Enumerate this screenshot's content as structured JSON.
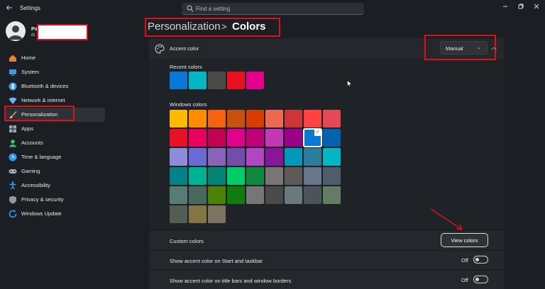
{
  "window": {
    "title": "Settings",
    "controls": [
      "minimize",
      "maximize",
      "close"
    ]
  },
  "search": {
    "placeholder": "Find a setting"
  },
  "profile": {
    "name": "Pa",
    "sub": "di"
  },
  "sidebar": {
    "items": [
      {
        "label": "Home",
        "icon": "home-icon",
        "color": "#e0863a"
      },
      {
        "label": "System",
        "icon": "monitor-icon",
        "color": "#3b9be8"
      },
      {
        "label": "Bluetooth & devices",
        "icon": "bluetooth-icon",
        "color": "#3b9be8"
      },
      {
        "label": "Network & internet",
        "icon": "wifi-icon",
        "color": "#67b7f0"
      },
      {
        "label": "Personalization",
        "icon": "brush-icon",
        "color": "#e8a25c",
        "active": true
      },
      {
        "label": "Apps",
        "icon": "apps-icon",
        "color": "#9aa6b3"
      },
      {
        "label": "Accounts",
        "icon": "person-icon",
        "color": "#43c07b"
      },
      {
        "label": "Time & language",
        "icon": "globe-clock-icon",
        "color": "#3b9be8"
      },
      {
        "label": "Gaming",
        "icon": "controller-icon",
        "color": "#a8b2bd"
      },
      {
        "label": "Accessibility",
        "icon": "accessibility-icon",
        "color": "#3b9be8"
      },
      {
        "label": "Privacy & security",
        "icon": "shield-icon",
        "color": "#8c99a6"
      },
      {
        "label": "Windows Update",
        "icon": "update-icon",
        "color": "#3b9be8"
      }
    ]
  },
  "breadcrumb": {
    "parent": "Personalization",
    "separator": ">",
    "current": "Colors"
  },
  "accent": {
    "label": "Accent color",
    "mode": "Manual",
    "recent_label": "Recent colors",
    "recent_colors": [
      "#0a78d7",
      "#00b7c3",
      "#4c4a48",
      "#e81123",
      "#e3008c"
    ],
    "windows_label": "Windows colors",
    "selected_color": "#0a78d7",
    "windows_colors": [
      [
        "#ffb900",
        "#ff8c00",
        "#f7630c",
        "#ca5010",
        "#da3b01",
        "#ef6950",
        "#d13438",
        "#ff4343",
        "#e74856"
      ],
      [
        "#e81123",
        "#ea005e",
        "#c30052",
        "#e3008c",
        "#bf0077",
        "#c239b3",
        "#9a0089",
        "#0a78d7",
        "#0063b1"
      ],
      [
        "#8e8cd8",
        "#6b69d6",
        "#8764b8",
        "#744da9",
        "#b146c2",
        "#881798",
        "#0099bc",
        "#2d7d9a",
        "#00b7c3"
      ],
      [
        "#038387",
        "#00b294",
        "#018574",
        "#00cc6a",
        "#10893e",
        "#7a7574",
        "#5d5a58",
        "#68768a",
        "#515c6b"
      ],
      [
        "#567c73",
        "#486860",
        "#498205",
        "#107c10",
        "#767676",
        "#4c4a48",
        "#69797e",
        "#4a5459",
        "#647c64"
      ],
      [
        "#525e54",
        "#847545",
        "#7e735f"
      ]
    ]
  },
  "custom_colors": {
    "label": "Custom colors",
    "button": "View colors"
  },
  "toggles": [
    {
      "label": "Show accent color on Start and taskbar",
      "state": "Off"
    },
    {
      "label": "Show accent color on title bars and window borders",
      "state": "Off"
    }
  ],
  "annotation_color": "#e0101a"
}
